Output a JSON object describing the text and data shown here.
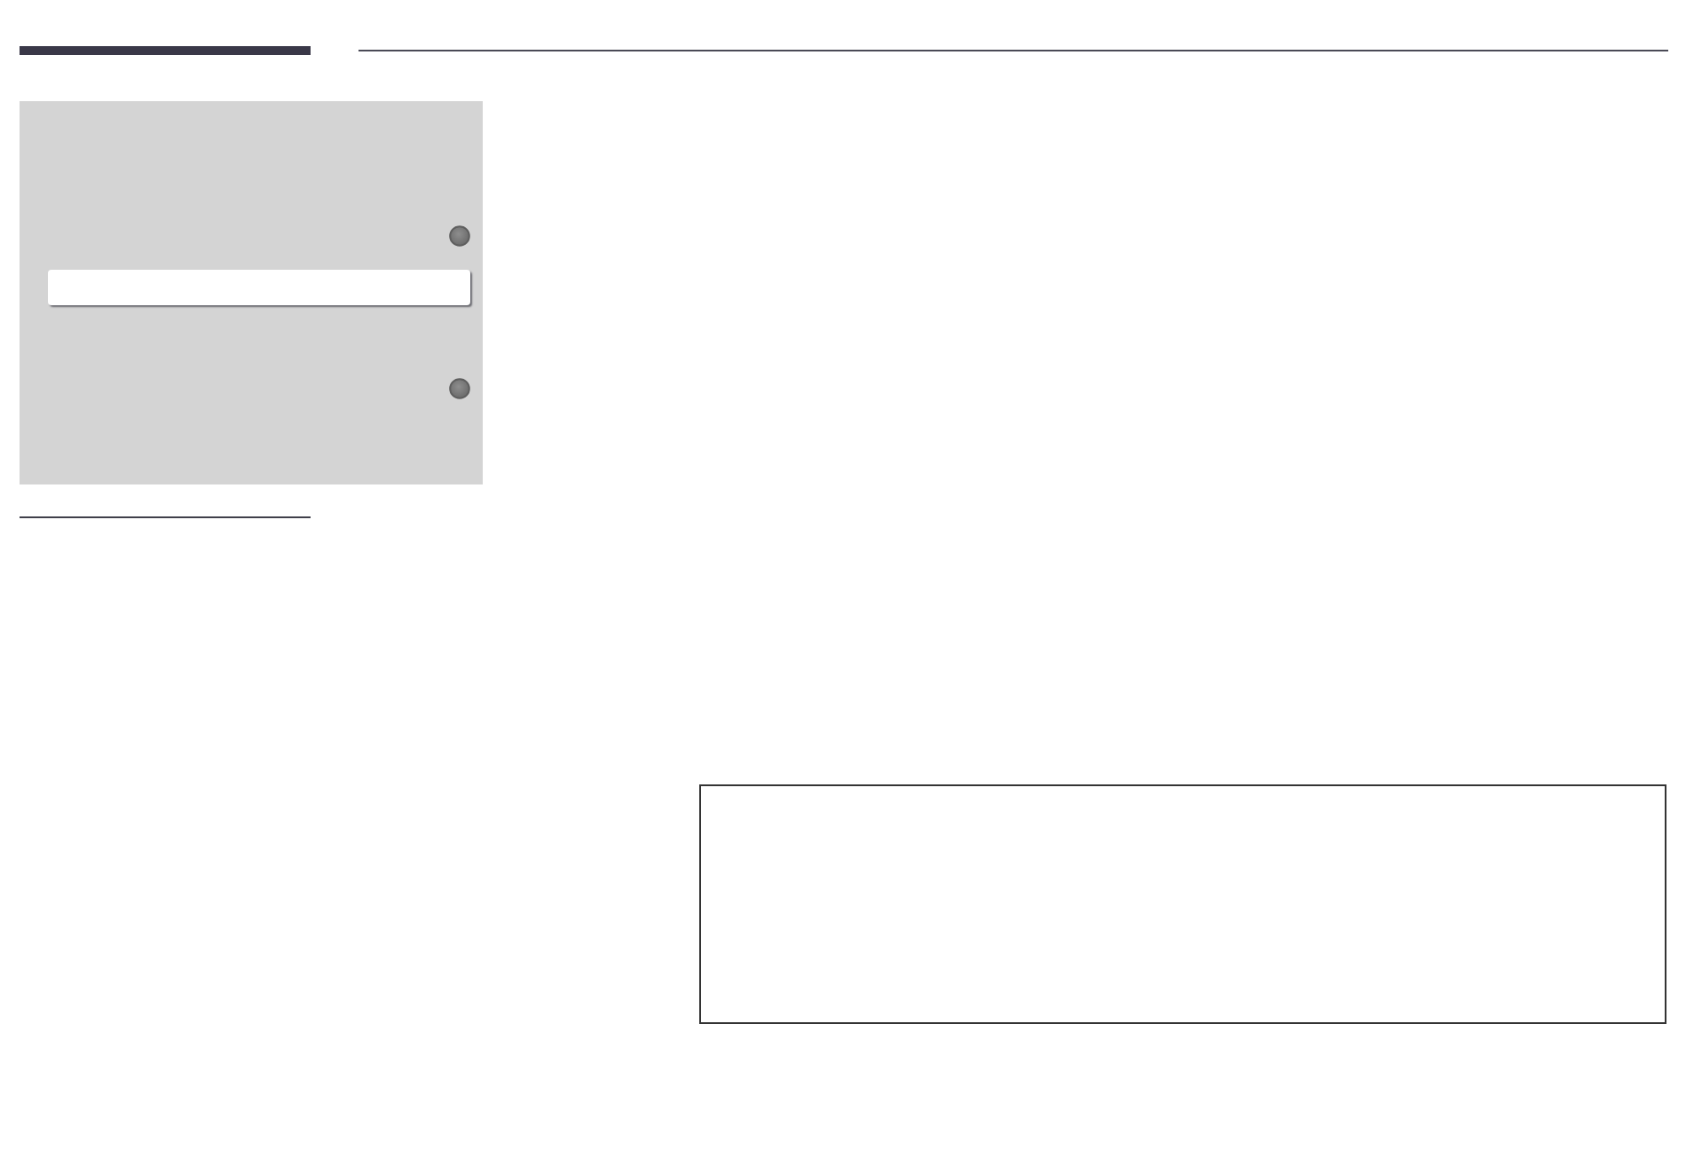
{
  "menu": {
    "items": [
      {
        "kind": "dot",
        "selected": false
      },
      {
        "kind": "plain",
        "selected": true
      },
      {
        "kind": "dot",
        "selected": false
      }
    ]
  }
}
